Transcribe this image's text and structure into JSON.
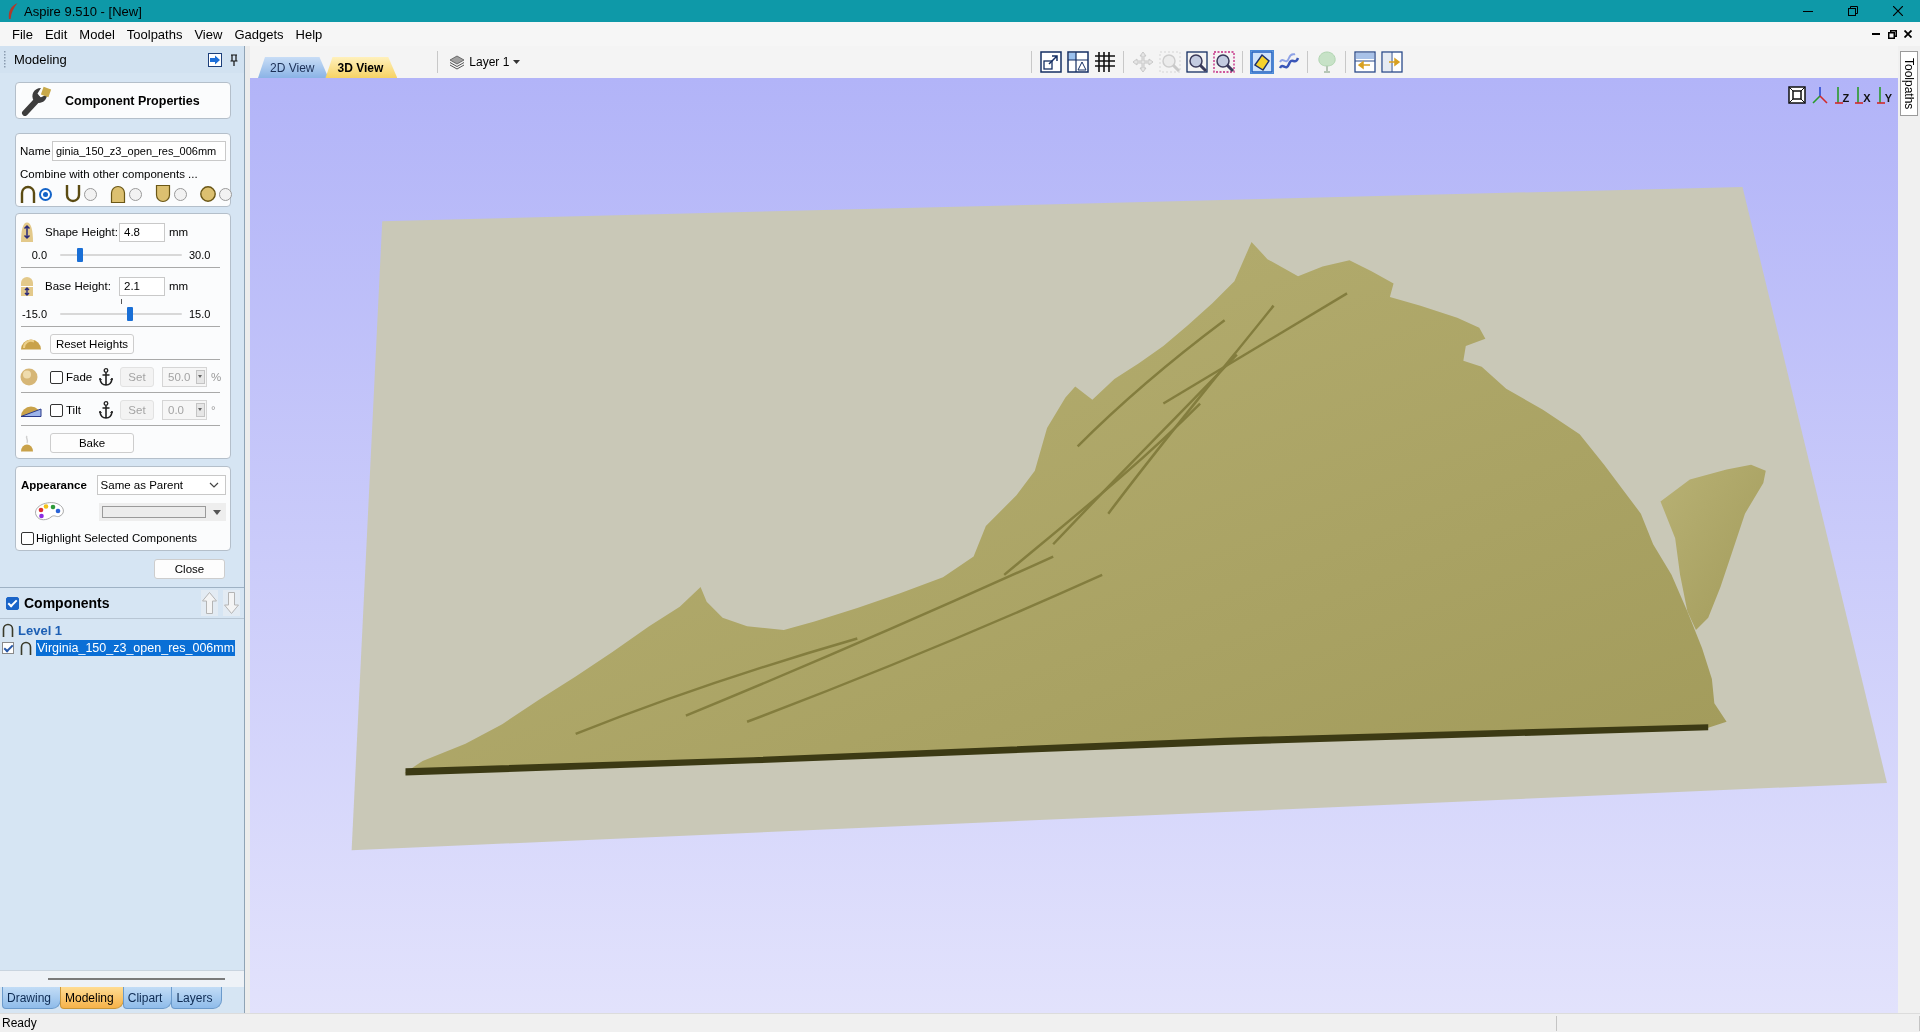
{
  "window": {
    "title": "Aspire 9.510 - [New]"
  },
  "menu": [
    "File",
    "Edit",
    "Model",
    "Toolpaths",
    "View",
    "Gadgets",
    "Help"
  ],
  "panel": {
    "title": "Modeling",
    "form": {
      "title": "Component Properties",
      "name_field": {
        "label": "Name",
        "value": "ginia_150_z3_open_res_006mm"
      },
      "combine": {
        "label": "Combine with other components ...",
        "modes": [
          {
            "kind": "add",
            "selected": true
          },
          {
            "kind": "subtract",
            "selected": false
          },
          {
            "kind": "merge",
            "selected": false
          },
          {
            "kind": "low",
            "selected": false
          },
          {
            "kind": "multiply",
            "selected": false
          }
        ]
      },
      "heights": [
        {
          "kind": "shape",
          "label": "Shape Height:",
          "value": "4.8",
          "unit": "mm",
          "min": "0.0",
          "max": "30.0",
          "level": 0.16
        },
        {
          "kind": "base",
          "label": "Base Height:",
          "value": "2.1",
          "unit": "mm",
          "min": "-15.0",
          "max": "15.0",
          "level": 0.57
        }
      ],
      "reset_button": "Reset Heights",
      "effects": [
        {
          "kind": "fade",
          "label": "Fade",
          "checked": false,
          "button": "Set",
          "value": "50.0",
          "unit": "%",
          "disabled": true
        },
        {
          "kind": "tilt",
          "label": "Tilt",
          "checked": false,
          "button": "Set",
          "value": "0.0",
          "unit": "°",
          "disabled": true
        }
      ],
      "bake_button": "Bake",
      "appearance": {
        "label": "Appearance",
        "value": "Same as Parent"
      },
      "highlight": {
        "label": "Highlight Selected Components",
        "checked": false
      },
      "close_button": "Close"
    }
  },
  "components": {
    "title": "Components",
    "checked": true,
    "tree": [
      {
        "kind": "level",
        "label": "Level 1",
        "children": [
          {
            "kind": "component",
            "label": "Virginia_150_z3_open_res_006mm",
            "checked": true,
            "selected": true
          }
        ]
      }
    ]
  },
  "panel_tabs": [
    {
      "label": "Drawing",
      "selected": false
    },
    {
      "label": "Modeling",
      "selected": true
    },
    {
      "label": "Clipart",
      "selected": false
    },
    {
      "label": "Layers",
      "selected": false
    }
  ],
  "view_tabs": [
    {
      "label": "2D View",
      "selected": false
    },
    {
      "label": "3D View",
      "selected": true
    }
  ],
  "layer": {
    "label": "Layer 1"
  },
  "toolbar": [
    [
      {
        "kind": "resize",
        "disabled": false,
        "on": false
      },
      {
        "kind": "layout",
        "disabled": false,
        "on": false
      },
      {
        "kind": "grid",
        "disabled": false,
        "on": false
      }
    ],
    [
      {
        "kind": "pan",
        "disabled": true,
        "on": false
      },
      {
        "kind": "zoom-extents",
        "disabled": true,
        "on": false
      },
      {
        "kind": "zoom",
        "disabled": false,
        "on": false
      },
      {
        "kind": "zoom-box",
        "disabled": false,
        "on": false
      }
    ],
    [
      {
        "kind": "shade",
        "disabled": false,
        "on": true
      },
      {
        "kind": "wave",
        "disabled": false,
        "on": false
      }
    ],
    [
      {
        "kind": "tree",
        "disabled": true,
        "on": false
      }
    ],
    [
      {
        "kind": "split-left",
        "disabled": false,
        "on": false
      },
      {
        "kind": "split-right",
        "disabled": false,
        "on": false
      }
    ]
  ],
  "view_buttons": [
    {
      "kind": "fit"
    },
    {
      "kind": "iso"
    },
    {
      "kind": "axis",
      "label": "Z"
    },
    {
      "kind": "axis",
      "label": "X"
    },
    {
      "kind": "axis",
      "label": "Y"
    }
  ],
  "side_tabs": [
    {
      "label": "Toolpaths"
    }
  ],
  "status_bar": {
    "text": "Ready"
  }
}
